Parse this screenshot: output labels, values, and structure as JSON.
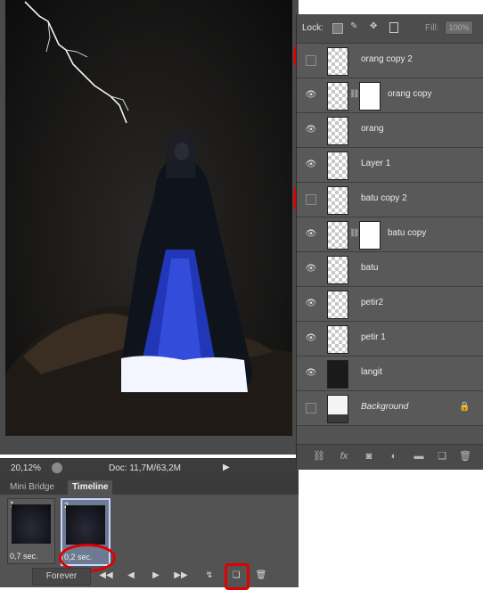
{
  "layers_panel": {
    "lock_label": "Lock:",
    "fill_label": "Fill:",
    "fill_value": "100%",
    "layers": [
      {
        "name": "orang copy 2",
        "visible": false,
        "italic": false,
        "has_mask": false
      },
      {
        "name": "orang copy",
        "visible": true,
        "italic": false,
        "has_mask": true
      },
      {
        "name": "orang",
        "visible": true,
        "italic": false,
        "has_mask": false
      },
      {
        "name": "Layer 1",
        "visible": true,
        "italic": false,
        "has_mask": false
      },
      {
        "name": "batu copy 2",
        "visible": false,
        "italic": false,
        "has_mask": false
      },
      {
        "name": "batu copy",
        "visible": true,
        "italic": false,
        "has_mask": true
      },
      {
        "name": "batu",
        "visible": true,
        "italic": false,
        "has_mask": false
      },
      {
        "name": "petir2",
        "visible": true,
        "italic": false,
        "has_mask": false
      },
      {
        "name": "petir 1",
        "visible": true,
        "italic": false,
        "has_mask": false
      },
      {
        "name": "langit",
        "visible": true,
        "italic": false,
        "has_mask": false
      },
      {
        "name": "Background",
        "visible": false,
        "italic": true,
        "has_mask": false,
        "locked": true
      }
    ],
    "footer_icons": [
      "link-icon",
      "fx-icon",
      "mask-icon",
      "adjustment-icon",
      "folder-icon",
      "new-layer-icon",
      "trash-icon"
    ]
  },
  "status": {
    "zoom": "20,12%",
    "doc": "Doc: 11,7M/63,2M"
  },
  "timeline": {
    "tabs": [
      "Mini Bridge",
      "Timeline"
    ],
    "active_tab": "Timeline",
    "frames": [
      {
        "number": "1",
        "delay": "0,7 sec."
      },
      {
        "number": "2",
        "delay": "0,2 sec."
      }
    ],
    "loop": "Forever",
    "controls": [
      "first-frame-icon",
      "prev-frame-icon",
      "play-icon",
      "next-frame-icon",
      "tween-icon",
      "duplicate-frame-icon",
      "delete-frame-icon"
    ]
  },
  "colors": {
    "annotation_red": "#e00000",
    "panel_bg": "#535353"
  }
}
